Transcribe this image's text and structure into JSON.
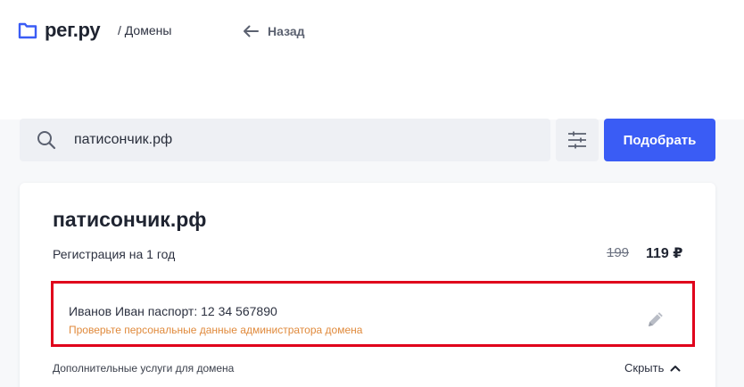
{
  "header": {
    "logo_text": "рег.ру",
    "breadcrumb": "/ Домены",
    "back_label": "Назад"
  },
  "search": {
    "value": "патисончик.рф",
    "submit_label": "Подобрать"
  },
  "domain_card": {
    "domain": "патисончик.рф",
    "registration_label": "Регистрация на 1 год",
    "old_price": "199",
    "new_price": "119 ₽",
    "admin_details": "Иванов Иван паспорт: 12 34 567890",
    "admin_warning": "Проверьте персональные данные администратора домена",
    "extra_services_label": "Дополнительные услуги для домена",
    "collapse_label": "Скрыть"
  },
  "colors": {
    "accent": "#3a5cf5",
    "highlight_border": "#e0001b",
    "warning_text": "#e08a3c"
  }
}
